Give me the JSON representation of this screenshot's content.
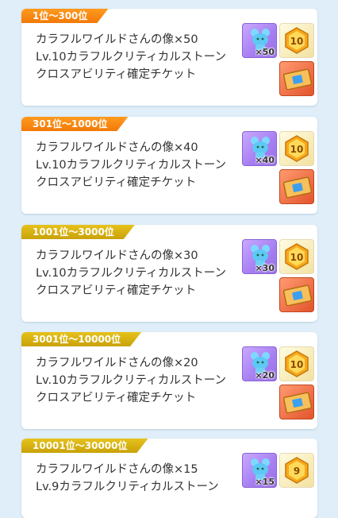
{
  "rewards": [
    {
      "rank_label": "1位～300位",
      "tab_color": "orange",
      "lines": [
        "カラフルワイルドさんの像×50",
        "Lv.10カラフルクリティカルストーン",
        "クロスアビリティ確定チケット"
      ],
      "qty_label": "×50",
      "stone_level": "10",
      "has_ticket": true
    },
    {
      "rank_label": "301位～1000位",
      "tab_color": "orange",
      "lines": [
        "カラフルワイルドさんの像×40",
        "Lv.10カラフルクリティカルストーン",
        "クロスアビリティ確定チケット"
      ],
      "qty_label": "×40",
      "stone_level": "10",
      "has_ticket": true
    },
    {
      "rank_label": "1001位～3000位",
      "tab_color": "gold",
      "lines": [
        "カラフルワイルドさんの像×30",
        "Lv.10カラフルクリティカルストーン",
        "クロスアビリティ確定チケット"
      ],
      "qty_label": "×30",
      "stone_level": "10",
      "has_ticket": true
    },
    {
      "rank_label": "3001位～10000位",
      "tab_color": "gold",
      "lines": [
        "カラフルワイルドさんの像×20",
        "Lv.10カラフルクリティカルストーン",
        "クロスアビリティ確定チケット"
      ],
      "qty_label": "×20",
      "stone_level": "10",
      "has_ticket": true
    },
    {
      "rank_label": "10001位～30000位",
      "tab_color": "gold",
      "lines": [
        "カラフルワイルドさんの像×15",
        "Lv.9カラフルクリティカルストーン"
      ],
      "qty_label": "×15",
      "stone_level": "9",
      "has_ticket": false
    }
  ]
}
